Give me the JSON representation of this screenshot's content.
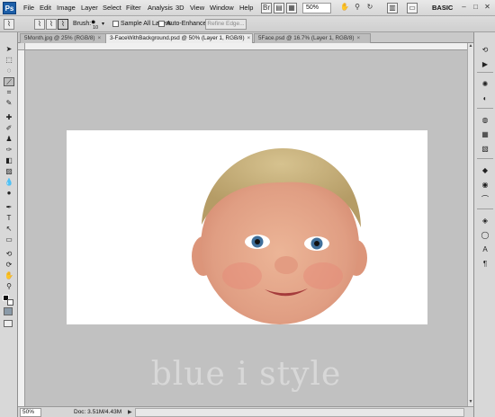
{
  "app": {
    "logo": "Ps"
  },
  "menu": [
    "File",
    "Edit",
    "Image",
    "Layer",
    "Select",
    "Filter",
    "Analysis",
    "3D",
    "View",
    "Window",
    "Help"
  ],
  "appbar": {
    "zoom": "50%",
    "workspace": "BASIC",
    "icons": [
      "bridge-icon",
      "minibridge-icon",
      "extras-icon",
      "hand-icon",
      "rotate-view-icon",
      "zoom-tool-icon",
      "arrange-documents-icon",
      "screen-mode-icon"
    ]
  },
  "window_controls": {
    "minimize": "–",
    "maximize": "□",
    "close": "✕"
  },
  "options": {
    "brush_label": "Brush:",
    "brush_size": "10",
    "sample_all_layers": "Sample All Layers",
    "auto_enhance": "Auto-Enhance",
    "refine_edge": "Refine Edge..."
  },
  "tabs": [
    {
      "label": "5Month.jpg @ 25% (RGB/8)",
      "active": false
    },
    {
      "label": "3-FaceWithBackground.psd @ 50% (Layer 1, RGB/8)",
      "active": true
    },
    {
      "label": "5Face.psd @ 16.7% (Layer 1, RGB/8)",
      "active": false
    }
  ],
  "status": {
    "zoom": "50%",
    "doc": "Doc: 3.51M/4.43M"
  },
  "watermark": "blue i style",
  "colors": {
    "canvas": "#ffffff",
    "workspace": "#c1c1c1",
    "skin": "#e2a689",
    "eyes": "#3f6f9a",
    "hair": "#c9b07a"
  }
}
